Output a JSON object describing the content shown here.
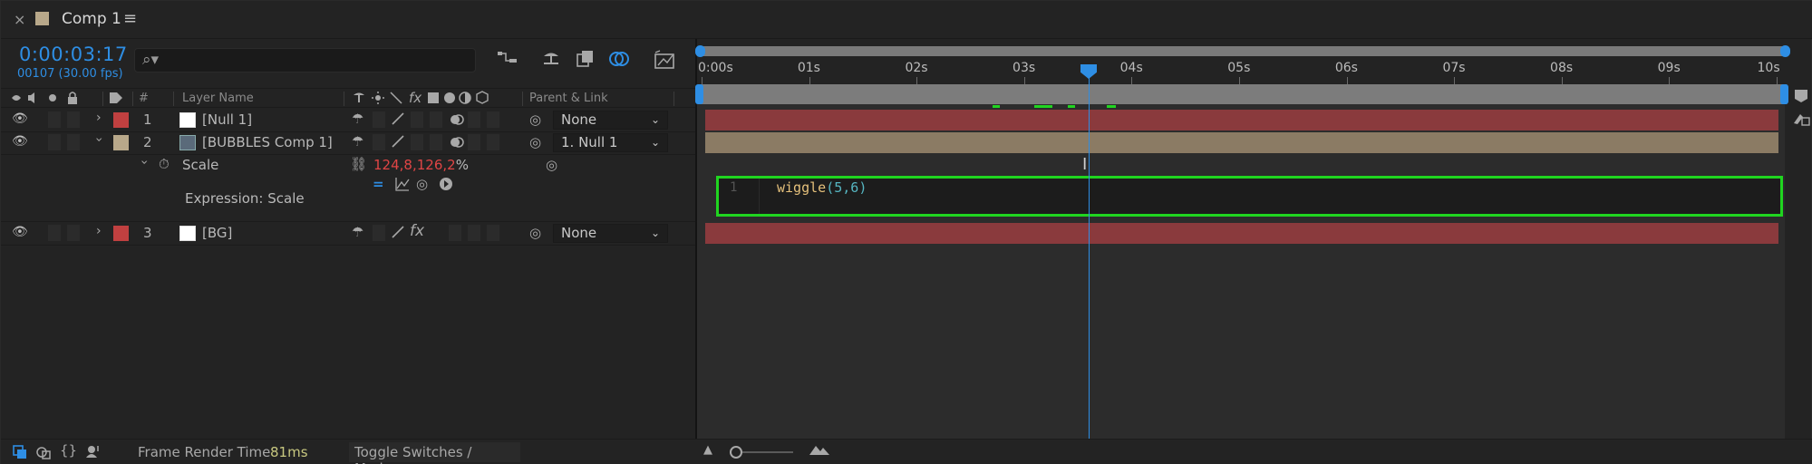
{
  "tab": {
    "title": "Comp 1",
    "close_icon": "close-icon",
    "menu_icon": "hamburger-icon",
    "swatch_color": "#b8a88a"
  },
  "header": {
    "timecode": "0:00:03:17",
    "frame_info": "00107 (30.00 fps)"
  },
  "columns": {
    "hash": "#",
    "layer_name": "Layer Name",
    "parent_link": "Parent & Link"
  },
  "layers": [
    {
      "index": "1",
      "name": "[Null 1]",
      "label_color": "#c04040",
      "parent": "None"
    },
    {
      "index": "2",
      "name": "[BUBBLES Comp 1]",
      "label_color": "#b8a88a",
      "parent": "1. Null 1"
    },
    {
      "index": "3",
      "name": "[BG]",
      "label_color": "#c04040",
      "parent": "None"
    }
  ],
  "scale": {
    "label": "Scale",
    "value_x": "124,8",
    "comma": ",",
    "value_y": "126,2",
    "unit": "%"
  },
  "expression": {
    "label": "Expression: Scale",
    "line_number": "1",
    "fn": "wiggle",
    "open": "(",
    "args": "5,6",
    "close": ")"
  },
  "ruler": [
    "0:00s",
    "01s",
    "02s",
    "03s",
    "04s",
    "05s",
    "06s",
    "07s",
    "08s",
    "09s",
    "10s"
  ],
  "footer": {
    "render_label": "Frame Render Time",
    "render_value": "81ms",
    "toggle": "Toggle Switches / Modes"
  },
  "colors": {
    "accent": "#2e8ee4",
    "highlight": "#20d520",
    "null_bar": "#8a3a3d",
    "comp_bar": "#8b7b64",
    "value_red": "#e04545"
  }
}
